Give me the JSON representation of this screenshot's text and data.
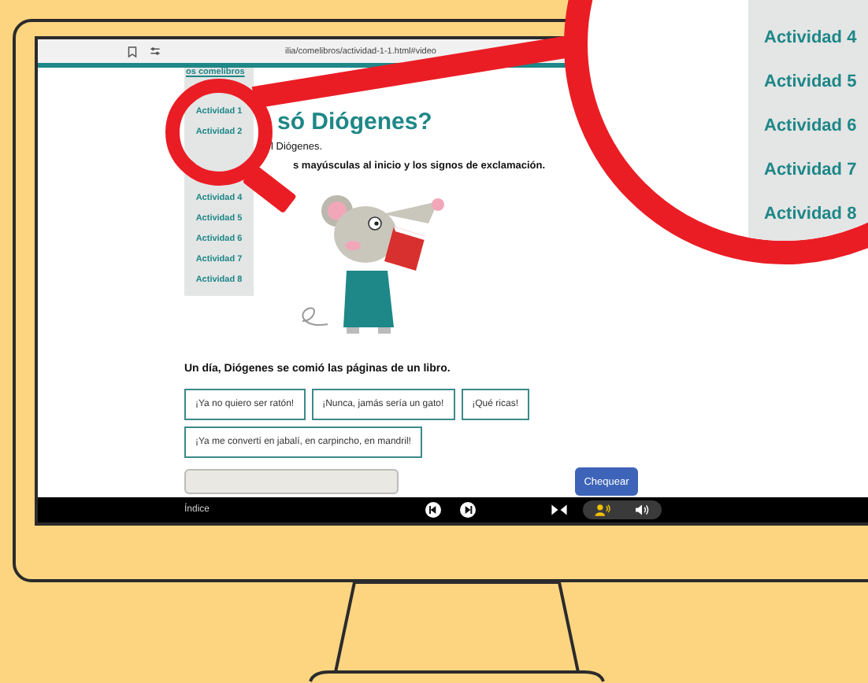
{
  "browser": {
    "url": "ilia/comelibros/actividad-1-1.html#video"
  },
  "sidebar": {
    "header": "os comelibros",
    "items": [
      {
        "label": "Actividad 1"
      },
      {
        "label": "Actividad 2"
      },
      {
        "label": "Actividad 4"
      },
      {
        "label": "Actividad 5"
      },
      {
        "label": "Actividad 6"
      },
      {
        "label": "Actividad 7"
      },
      {
        "label": "Actividad 8"
      }
    ]
  },
  "title": "só Diógenes?",
  "instructions": [
    "l Diógenes.",
    "s mayúsculas al inicio y los signos de exclamación."
  ],
  "sentence": "Un día, Diógenes se comió las páginas de un libro.",
  "options": [
    "¡Ya no quiero ser ratón!",
    "¡Nunca, jamás sería un gato!",
    "¡Qué ricas!",
    "¡Ya me convertí en jabalí, en carpincho, en mandril!"
  ],
  "check_button": "Chequear",
  "footer": {
    "index_label": "Índice"
  },
  "magnifier": {
    "items": [
      "Actividad 4",
      "Actividad 5",
      "Actividad 6",
      "Actividad 7",
      "Actividad 8"
    ]
  }
}
